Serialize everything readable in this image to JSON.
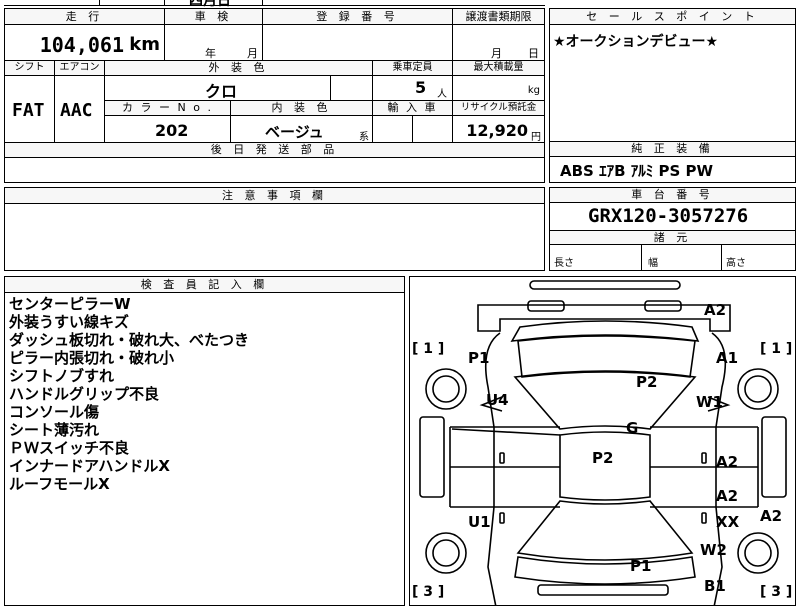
{
  "top_partial": {
    "fragment": "四月日"
  },
  "vehicle": {
    "mileage_label": "走 行",
    "mileage_value": "104,061",
    "mileage_unit": "km",
    "shaken_label": "車 検",
    "shaken_year_unit": "年",
    "shaken_month_unit": "月",
    "registration_label": "登 録 番 号",
    "transfer_label": "譲渡書類期限",
    "transfer_month_unit": "月",
    "transfer_day_unit": "日",
    "shift_label": "シフト",
    "shift_value": "FAT",
    "aircon_label": "エアコン",
    "aircon_value": "AAC",
    "exterior_label": "外 装 色",
    "exterior_value": "クロ",
    "capacity_label": "乗車定員",
    "capacity_value": "5",
    "capacity_unit": "人",
    "maxload_label": "最大積載量",
    "maxload_unit": "kg",
    "color_no_label": "カ ラ ー N o .",
    "color_no_value": "202",
    "interior_label": "内 装 色",
    "interior_value": "ベージュ",
    "interior_suffix": "系",
    "import_label": "輸 入 車",
    "recycle_label": "リサイクル預託金",
    "recycle_value": "12,920",
    "recycle_unit": "円",
    "parts_label": "後 日 発 送 部 品",
    "notes_label": "注 意 事 項 欄"
  },
  "sales": {
    "label": "セ ー ル ス ポ イ ン ト",
    "text": "★オークションデビュー★",
    "equipment_label": "純 正 装 備",
    "equipment_text": "ABS ｴｱB ｱﾙﾐ PS PW"
  },
  "chassis": {
    "label": "車 台 番 号",
    "value": "GRX120-3057276",
    "specs_label": "諸 元",
    "length_label": "長さ",
    "width_label": "幅",
    "height_label": "高さ"
  },
  "inspector": {
    "label": "検 査 員 記 入 欄",
    "lines": [
      "センターピラーW",
      "外装うすい線キズ",
      "ダッシュ板切れ・破れ大、べたつき",
      "ピラー内張切れ・破れ小",
      "シフトノブすれ",
      "ハンドルグリップ不良",
      "コンソール傷",
      "シート薄汚れ",
      "ＰＷスイッチ不良",
      "インナードアハンドルX",
      "ルーフモールX"
    ]
  },
  "diagram": {
    "bracket_tl": "[ 1 ]",
    "bracket_tr": "[ 1 ]",
    "bracket_bl": "[ 3 ]",
    "bracket_br": "[ 3 ]",
    "marks": {
      "a2_top": "A2",
      "p1_left": "P1",
      "a1_right": "A1",
      "p2_dash": "P2",
      "u4": "U4",
      "w1": "W1",
      "g": "G",
      "p2_roof": "P2",
      "a2_rdoor": "A2",
      "a2_rdoor2": "A2",
      "xx": "XX",
      "a2_rside": "A2",
      "u1": "U1",
      "w2": "W2",
      "p1_rear": "P1",
      "b1": "B1"
    }
  }
}
